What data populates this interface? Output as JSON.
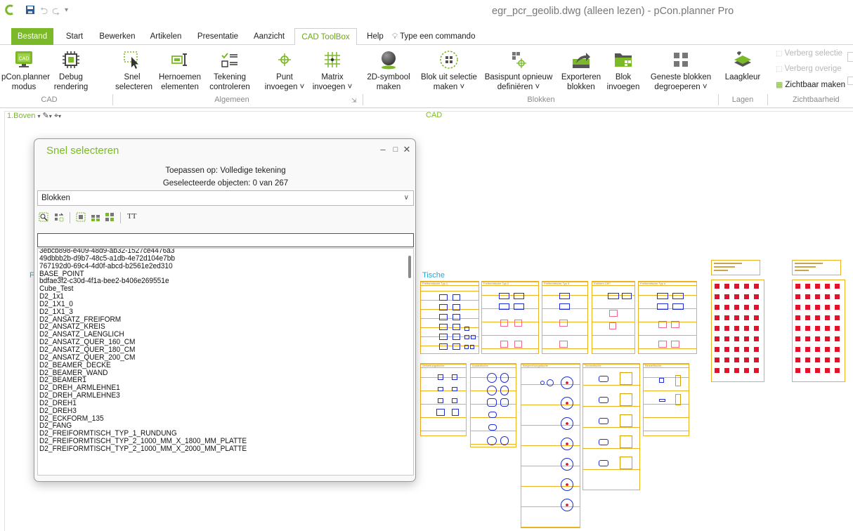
{
  "window": {
    "title": "egr_pcr_geolib.dwg (alleen lezen) - pCon.planner Pro"
  },
  "tabs": [
    {
      "label": "Bestand"
    },
    {
      "label": "Start"
    },
    {
      "label": "Bewerken"
    },
    {
      "label": "Artikelen"
    },
    {
      "label": "Presentatie"
    },
    {
      "label": "Aanzicht"
    },
    {
      "label": "CAD ToolBox"
    },
    {
      "label": "Help"
    }
  ],
  "command_search": {
    "label": "Type een commando"
  },
  "ribbon": {
    "buttons": [
      {
        "line1": "pCon.planner",
        "line2": "modus",
        "icon": "monitor-cad-icon"
      },
      {
        "line1": "Debug",
        "line2": "rendering",
        "icon": "chip-icon"
      },
      {
        "line1": "Snel",
        "line2": "selecteren",
        "icon": "quick-select-icon"
      },
      {
        "line1": "Hernoemen",
        "line2": "elementen",
        "icon": "rename-icon"
      },
      {
        "line1": "Tekening",
        "line2": "controleren",
        "icon": "checklist-icon"
      },
      {
        "line1": "Punt",
        "line2": "invoegen ˅",
        "icon": "point-icon"
      },
      {
        "line1": "Matrix",
        "line2": "invoegen ˅",
        "icon": "matrix-icon"
      },
      {
        "line1": "2D-symbool",
        "line2": "maken",
        "icon": "sphere-icon"
      },
      {
        "line1": "Blok uit selectie",
        "line2": "maken ˅",
        "icon": "block-from-selection-icon"
      },
      {
        "line1": "Basispunt opnieuw",
        "line2": "definiëren ˅",
        "icon": "basepoint-icon"
      },
      {
        "line1": "Exporteren",
        "line2": "blokken",
        "icon": "export-icon"
      },
      {
        "line1": "Blok",
        "line2": "invoegen",
        "icon": "insert-block-icon"
      },
      {
        "line1": "Geneste blokken",
        "line2": "degroeperen ˅",
        "icon": "ungroup-icon"
      },
      {
        "line1": "Laagkleur",
        "line2": "",
        "icon": "layers-icon"
      }
    ],
    "small_buttons": [
      {
        "label": "Verberg selectie",
        "enabled": false
      },
      {
        "label": "Verberg overige",
        "enabled": false
      },
      {
        "label": "Zichtbaar maken",
        "enabled": true
      }
    ],
    "groups": {
      "cad": "CAD",
      "algemeen": "Algemeen",
      "blokken": "Blokken",
      "lagen": "Lagen",
      "zichtbaarheid": "Zichtbaarheid"
    }
  },
  "viewport": {
    "view_label": "1.Boven",
    "title": "CAD"
  },
  "dialog": {
    "title": "Snel selecteren",
    "apply_to": "Toepassen op: Volledige tekening",
    "selected_count": "Geselecteerde objecten: 0 van 267",
    "filter_value": "Blokken",
    "text_tool": "TT",
    "search_value": "",
    "items": [
      "3ebcb898-e409-48d9-ab32-1527ce4476a3",
      "49dbbb2b-d9b7-48c5-a1db-4e72d104e7bb",
      "767192d0-69c4-4d0f-abcd-b2561e2ed310",
      "BASE_POINT",
      "bdfae3f2-c30d-4f1a-bee2-b406e269551e",
      "Cube_Test",
      "D2_1x1",
      "D2_1X1_0",
      "D2_1X1_3",
      "D2_ANSATZ_FREIFORM",
      "D2_ANSATZ_KREIS",
      "D2_ANSATZ_LAENGLICH",
      "D2_ANSATZ_QUER_160_CM",
      "D2_ANSATZ_QUER_180_CM",
      "D2_ANSATZ_QUER_200_CM",
      "D2_BEAMER_DECKE",
      "D2_BEAMER_WAND",
      "D2_BEAMER1",
      "D2_DREH_ARMLEHNE1",
      "D2_DREH_ARMLEHNE3",
      "D2_DREH1",
      "D2_DREH3",
      "D2_ECKFORM_135",
      "D2_FANG",
      "D2_FREIFORMTISCH_TYP_1_RUNDUNG",
      "D2_FREIFORMTISCH_TYP_2_1000_MM_X_1800_MM_PLATTE",
      "D2_FREIFORMTISCH_TYP_2_1000_MM_X_2000_MM_PLATTE"
    ]
  },
  "drawing": {
    "section_label": "Tische",
    "table_headers": [
      "Freiformtische Typ 1",
      "Freiformtische Typ 2",
      "Freiformtische Typ 3",
      "Eckform 135°",
      "Freiformtische Typ 4",
      "Verkettungstische",
      "Ansatztische",
      "Besprechungstische",
      "Tonnentische",
      "Beistelltische"
    ],
    "colors": {
      "frame": "#ecb21f",
      "shape": "#1f2ed0",
      "marker": "#e0122c",
      "accent": "#7bb928"
    }
  }
}
